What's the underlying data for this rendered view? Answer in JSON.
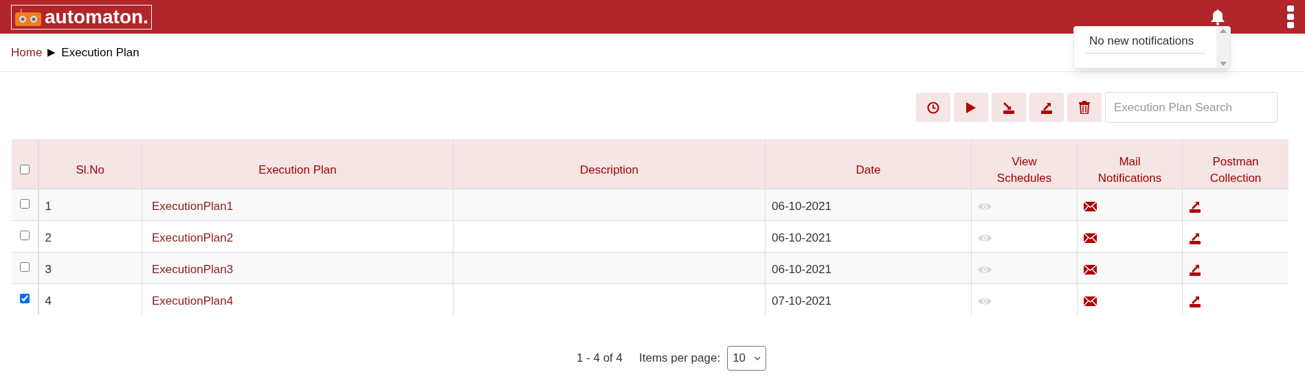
{
  "header": {
    "logo_text": "automaton."
  },
  "notifications": {
    "message": "No new notifications"
  },
  "breadcrumb": [
    {
      "label": "Home",
      "kind": "link"
    },
    {
      "label": "▶",
      "kind": "separator"
    },
    {
      "label": "Execution Plan",
      "kind": "current"
    }
  ],
  "search": {
    "placeholder": "Execution Plan Search"
  },
  "table": {
    "select_all": {
      "checked": false
    },
    "columns": [
      "Sl.No",
      "Execution Plan",
      "Description",
      "Date",
      "View Schedules",
      "Mail Notifications",
      "Postman Collection"
    ],
    "rows": [
      {
        "checked": false,
        "sl_no": "1",
        "execution_plan": "ExecutionPlan1",
        "date": "06-10-2021"
      },
      {
        "checked": false,
        "sl_no": "2",
        "execution_plan": "ExecutionPlan2",
        "date": "06-10-2021"
      },
      {
        "checked": false,
        "sl_no": "3",
        "execution_plan": "ExecutionPlan3",
        "date": "06-10-2021"
      },
      {
        "checked": true,
        "sl_no": "4",
        "execution_plan": "ExecutionPlan4",
        "date": "07-10-2021"
      }
    ]
  },
  "pagination": {
    "range": "1 - 4 of 4",
    "label": "Items per page:",
    "value": "10"
  }
}
